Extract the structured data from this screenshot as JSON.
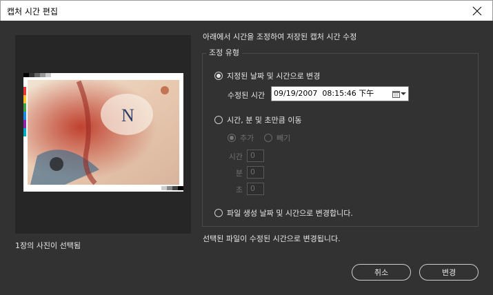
{
  "window": {
    "title": "캡처 시간 편집"
  },
  "preview": {
    "status": "1장의 사진이 선택됨"
  },
  "intro": "아래에서 시간을 조정하여 저장된 캡처 시간 수정",
  "group": {
    "legend": "조정 유형",
    "option1": {
      "label": "지정된 날짜 및 시간으로 변경",
      "selected": true,
      "field_label": "수정된 시간",
      "datetime_value": "09/19/2007  08:15:46 下午"
    },
    "option2": {
      "label": "시간, 분 및 초만큼 이동",
      "selected": false,
      "add_label": "추가",
      "subtract_label": "빼기",
      "hours_label": "시간",
      "minutes_label": "분",
      "seconds_label": "초",
      "hours_value": "0",
      "minutes_value": "0",
      "seconds_value": "0"
    },
    "option3": {
      "label": "파일 생성 날짜 및 시간으로 변경합니다.",
      "selected": false
    }
  },
  "status": "선택된 파일이 수정된 시간으로 변경됩니다.",
  "buttons": {
    "cancel": "취소",
    "apply": "변경"
  },
  "icons": {
    "close": "close-icon",
    "calendar": "calendar-icon",
    "dropdown": "chevron-down-icon"
  },
  "colors": {
    "dialog_bg": "#323232",
    "preview_bg": "#262626",
    "titlebar_bg": "#ffffff"
  }
}
